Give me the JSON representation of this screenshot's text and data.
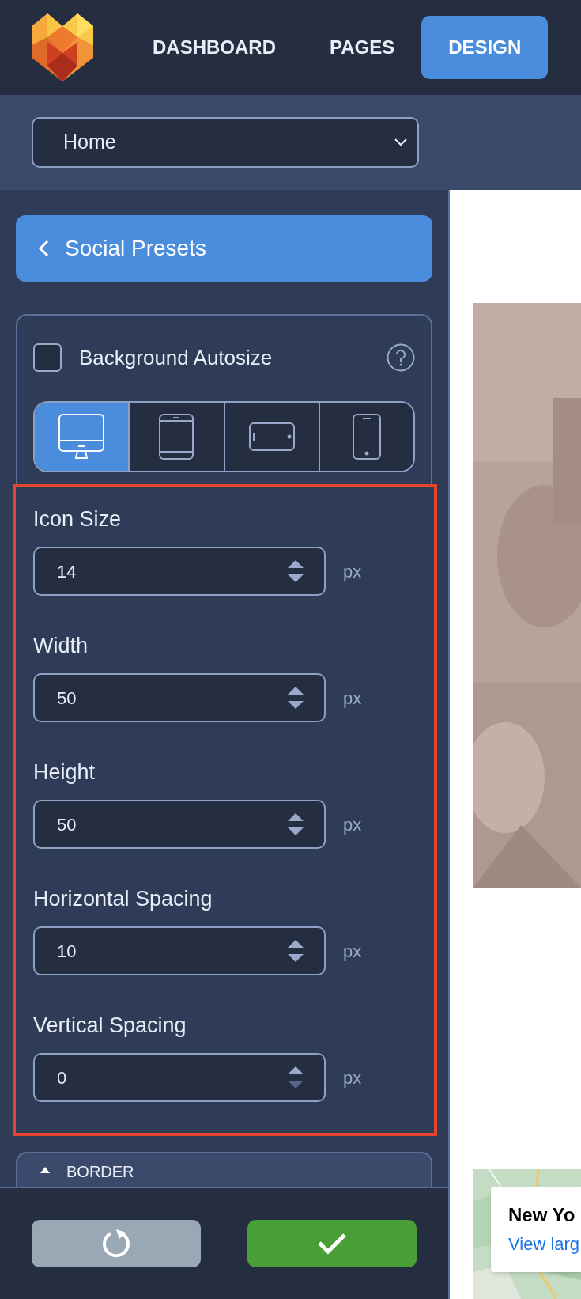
{
  "nav": {
    "items": [
      {
        "label": "DASHBOARD",
        "selected": false
      },
      {
        "label": "PAGES",
        "selected": false
      },
      {
        "label": "DESIGN",
        "selected": true
      }
    ]
  },
  "page_select": {
    "value": "Home"
  },
  "back_button": {
    "label": "Social Presets"
  },
  "background_autosize": {
    "label": "Background Autosize",
    "checked": false
  },
  "devices": [
    {
      "kind": "desktop",
      "selected": true
    },
    {
      "kind": "tablet",
      "selected": false
    },
    {
      "kind": "landscape",
      "selected": false
    },
    {
      "kind": "phone",
      "selected": false
    }
  ],
  "fields": [
    {
      "label": "Icon Size",
      "value": "14",
      "unit": "px",
      "decrement_disabled": false
    },
    {
      "label": "Width",
      "value": "50",
      "unit": "px",
      "decrement_disabled": false
    },
    {
      "label": "Height",
      "value": "50",
      "unit": "px",
      "decrement_disabled": false
    },
    {
      "label": "Horizontal Spacing",
      "value": "10",
      "unit": "px",
      "decrement_disabled": false
    },
    {
      "label": "Vertical Spacing",
      "value": "0",
      "unit": "px",
      "decrement_disabled": true
    }
  ],
  "border_section": {
    "label": "BORDER"
  },
  "footer": {
    "buttons": [
      {
        "kind": "reset"
      },
      {
        "kind": "confirm"
      }
    ]
  },
  "map_popup": {
    "title": "New Yo",
    "link": "View larg"
  }
}
